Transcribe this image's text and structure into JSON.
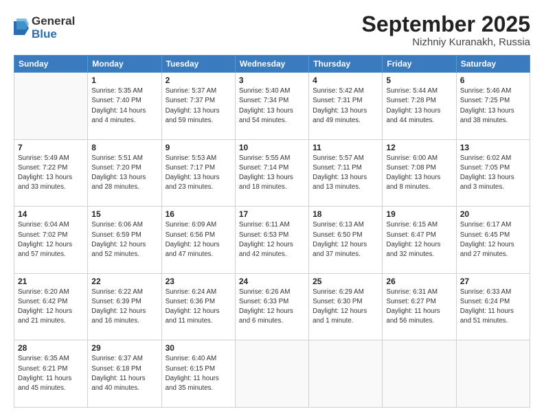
{
  "logo": {
    "general": "General",
    "blue": "Blue"
  },
  "title": {
    "month_year": "September 2025",
    "location": "Nizhniy Kuranakh, Russia"
  },
  "headers": [
    "Sunday",
    "Monday",
    "Tuesday",
    "Wednesday",
    "Thursday",
    "Friday",
    "Saturday"
  ],
  "weeks": [
    [
      {
        "day": "",
        "info": ""
      },
      {
        "day": "1",
        "info": "Sunrise: 5:35 AM\nSunset: 7:40 PM\nDaylight: 14 hours\nand 4 minutes."
      },
      {
        "day": "2",
        "info": "Sunrise: 5:37 AM\nSunset: 7:37 PM\nDaylight: 13 hours\nand 59 minutes."
      },
      {
        "day": "3",
        "info": "Sunrise: 5:40 AM\nSunset: 7:34 PM\nDaylight: 13 hours\nand 54 minutes."
      },
      {
        "day": "4",
        "info": "Sunrise: 5:42 AM\nSunset: 7:31 PM\nDaylight: 13 hours\nand 49 minutes."
      },
      {
        "day": "5",
        "info": "Sunrise: 5:44 AM\nSunset: 7:28 PM\nDaylight: 13 hours\nand 44 minutes."
      },
      {
        "day": "6",
        "info": "Sunrise: 5:46 AM\nSunset: 7:25 PM\nDaylight: 13 hours\nand 38 minutes."
      }
    ],
    [
      {
        "day": "7",
        "info": "Sunrise: 5:49 AM\nSunset: 7:22 PM\nDaylight: 13 hours\nand 33 minutes."
      },
      {
        "day": "8",
        "info": "Sunrise: 5:51 AM\nSunset: 7:20 PM\nDaylight: 13 hours\nand 28 minutes."
      },
      {
        "day": "9",
        "info": "Sunrise: 5:53 AM\nSunset: 7:17 PM\nDaylight: 13 hours\nand 23 minutes."
      },
      {
        "day": "10",
        "info": "Sunrise: 5:55 AM\nSunset: 7:14 PM\nDaylight: 13 hours\nand 18 minutes."
      },
      {
        "day": "11",
        "info": "Sunrise: 5:57 AM\nSunset: 7:11 PM\nDaylight: 13 hours\nand 13 minutes."
      },
      {
        "day": "12",
        "info": "Sunrise: 6:00 AM\nSunset: 7:08 PM\nDaylight: 13 hours\nand 8 minutes."
      },
      {
        "day": "13",
        "info": "Sunrise: 6:02 AM\nSunset: 7:05 PM\nDaylight: 13 hours\nand 3 minutes."
      }
    ],
    [
      {
        "day": "14",
        "info": "Sunrise: 6:04 AM\nSunset: 7:02 PM\nDaylight: 12 hours\nand 57 minutes."
      },
      {
        "day": "15",
        "info": "Sunrise: 6:06 AM\nSunset: 6:59 PM\nDaylight: 12 hours\nand 52 minutes."
      },
      {
        "day": "16",
        "info": "Sunrise: 6:09 AM\nSunset: 6:56 PM\nDaylight: 12 hours\nand 47 minutes."
      },
      {
        "day": "17",
        "info": "Sunrise: 6:11 AM\nSunset: 6:53 PM\nDaylight: 12 hours\nand 42 minutes."
      },
      {
        "day": "18",
        "info": "Sunrise: 6:13 AM\nSunset: 6:50 PM\nDaylight: 12 hours\nand 37 minutes."
      },
      {
        "day": "19",
        "info": "Sunrise: 6:15 AM\nSunset: 6:47 PM\nDaylight: 12 hours\nand 32 minutes."
      },
      {
        "day": "20",
        "info": "Sunrise: 6:17 AM\nSunset: 6:45 PM\nDaylight: 12 hours\nand 27 minutes."
      }
    ],
    [
      {
        "day": "21",
        "info": "Sunrise: 6:20 AM\nSunset: 6:42 PM\nDaylight: 12 hours\nand 21 minutes."
      },
      {
        "day": "22",
        "info": "Sunrise: 6:22 AM\nSunset: 6:39 PM\nDaylight: 12 hours\nand 16 minutes."
      },
      {
        "day": "23",
        "info": "Sunrise: 6:24 AM\nSunset: 6:36 PM\nDaylight: 12 hours\nand 11 minutes."
      },
      {
        "day": "24",
        "info": "Sunrise: 6:26 AM\nSunset: 6:33 PM\nDaylight: 12 hours\nand 6 minutes."
      },
      {
        "day": "25",
        "info": "Sunrise: 6:29 AM\nSunset: 6:30 PM\nDaylight: 12 hours\nand 1 minute."
      },
      {
        "day": "26",
        "info": "Sunrise: 6:31 AM\nSunset: 6:27 PM\nDaylight: 11 hours\nand 56 minutes."
      },
      {
        "day": "27",
        "info": "Sunrise: 6:33 AM\nSunset: 6:24 PM\nDaylight: 11 hours\nand 51 minutes."
      }
    ],
    [
      {
        "day": "28",
        "info": "Sunrise: 6:35 AM\nSunset: 6:21 PM\nDaylight: 11 hours\nand 45 minutes."
      },
      {
        "day": "29",
        "info": "Sunrise: 6:37 AM\nSunset: 6:18 PM\nDaylight: 11 hours\nand 40 minutes."
      },
      {
        "day": "30",
        "info": "Sunrise: 6:40 AM\nSunset: 6:15 PM\nDaylight: 11 hours\nand 35 minutes."
      },
      {
        "day": "",
        "info": ""
      },
      {
        "day": "",
        "info": ""
      },
      {
        "day": "",
        "info": ""
      },
      {
        "day": "",
        "info": ""
      }
    ]
  ]
}
